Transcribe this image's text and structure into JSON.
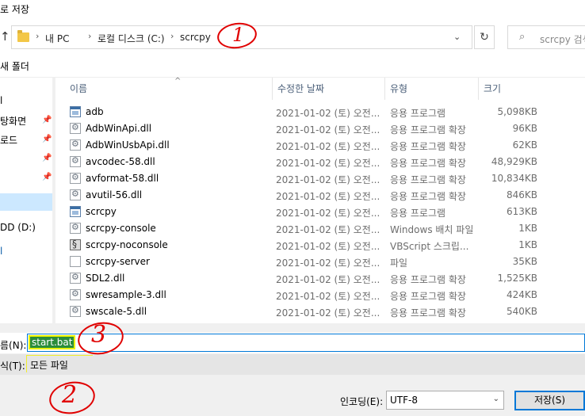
{
  "window": {
    "title": "로 저장"
  },
  "address": {
    "crumbs": [
      "내 PC",
      "로컬 디스크 (C:)",
      "scrcpy"
    ],
    "separator": "›",
    "search_placeholder": "scrcpy 검색"
  },
  "toolbar": {
    "new_folder": "새 폴더"
  },
  "nav": {
    "items": [
      "l",
      "탕화면",
      "로드",
      "",
      "",
      "",
      "DD (D:)",
      "l"
    ]
  },
  "columns": {
    "name": "이름",
    "date": "수정한 날짜",
    "type": "유형",
    "size": "크기"
  },
  "files": [
    {
      "name": "adb",
      "date": "2021-01-02 (토) 오전...",
      "type": "응용 프로그램",
      "size": "5,098KB",
      "icon": "app-icon"
    },
    {
      "name": "AdbWinApi.dll",
      "date": "2021-01-02 (토) 오전...",
      "type": "응용 프로그램 확장",
      "size": "96KB",
      "icon": "dll-icon"
    },
    {
      "name": "AdbWinUsbApi.dll",
      "date": "2021-01-02 (토) 오전...",
      "type": "응용 프로그램 확장",
      "size": "62KB",
      "icon": "dll-icon"
    },
    {
      "name": "avcodec-58.dll",
      "date": "2021-01-02 (토) 오전...",
      "type": "응용 프로그램 확장",
      "size": "48,929KB",
      "icon": "dll-icon"
    },
    {
      "name": "avformat-58.dll",
      "date": "2021-01-02 (토) 오전...",
      "type": "응용 프로그램 확장",
      "size": "10,834KB",
      "icon": "dll-icon"
    },
    {
      "name": "avutil-56.dll",
      "date": "2021-01-02 (토) 오전...",
      "type": "응용 프로그램 확장",
      "size": "846KB",
      "icon": "dll-icon"
    },
    {
      "name": "scrcpy",
      "date": "2021-01-02 (토) 오전...",
      "type": "응용 프로그램",
      "size": "613KB",
      "icon": "app-icon"
    },
    {
      "name": "scrcpy-console",
      "date": "2021-01-02 (토) 오전...",
      "type": "Windows 배치 파일",
      "size": "1KB",
      "icon": "bat-icon"
    },
    {
      "name": "scrcpy-noconsole",
      "date": "2021-01-02 (토) 오전...",
      "type": "VBScript 스크립...",
      "size": "1KB",
      "icon": "vbs-icon"
    },
    {
      "name": "scrcpy-server",
      "date": "2021-01-02 (토) 오전...",
      "type": "파일",
      "size": "35KB",
      "icon": "file-icon"
    },
    {
      "name": "SDL2.dll",
      "date": "2021-01-02 (토) 오전...",
      "type": "응용 프로그램 확장",
      "size": "1,525KB",
      "icon": "dll-icon"
    },
    {
      "name": "swresample-3.dll",
      "date": "2021-01-02 (토) 오전...",
      "type": "응용 프로그램 확장",
      "size": "424KB",
      "icon": "dll-icon"
    },
    {
      "name": "swscale-5.dll",
      "date": "2021-01-02 (토) 오전...",
      "type": "응용 프로그램 확장",
      "size": "540KB",
      "icon": "dll-icon"
    }
  ],
  "filename": {
    "label": "름(N):",
    "value": "start.bat"
  },
  "filetype": {
    "label": "식(T):",
    "value": "모든 파일"
  },
  "encoding": {
    "label": "인코딩(E):",
    "value": "UTF-8"
  },
  "save_label": "저장(S)",
  "annotations": [
    "1",
    "2",
    "3"
  ],
  "colors": {
    "accent": "#0078d7",
    "highlight": "#f2f000",
    "annotation": "#e00000",
    "selection": "#2a8d3a"
  }
}
